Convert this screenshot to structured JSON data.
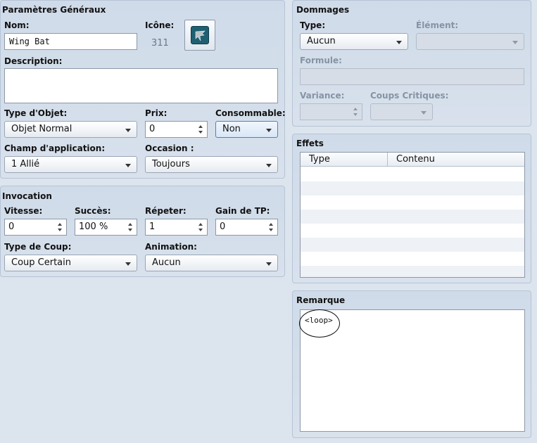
{
  "general": {
    "title": "Paramètres Généraux",
    "name_label": "Nom:",
    "name_value": "Wing Bat",
    "icon_label": "Icône:",
    "icon_index": "311",
    "icon_name": "bat-wing-icon",
    "description_label": "Description:",
    "description_value": "",
    "item_type_label": "Type d'Objet:",
    "item_type_value": "Objet Normal",
    "price_label": "Prix:",
    "price_value": "0",
    "consumable_label": "Consommable:",
    "consumable_value": "Non",
    "scope_label": "Champ d'application:",
    "scope_value": "1 Allié",
    "occasion_label": "Occasion :",
    "occasion_value": "Toujours"
  },
  "invocation": {
    "title": "Invocation",
    "speed_label": "Vitesse:",
    "speed_value": "0",
    "success_label": "Succès:",
    "success_value": "100 %",
    "repeat_label": "Répeter:",
    "repeat_value": "1",
    "tp_gain_label": "Gain de TP:",
    "tp_gain_value": "0",
    "hit_type_label": "Type de Coup:",
    "hit_type_value": "Coup Certain",
    "animation_label": "Animation:",
    "animation_value": "Aucun"
  },
  "damage": {
    "title": "Dommages",
    "type_label": "Type:",
    "type_value": "Aucun",
    "element_label": "Élément:",
    "element_value": "",
    "formula_label": "Formule:",
    "formula_value": "",
    "variance_label": "Variance:",
    "variance_value": "",
    "critical_label": "Coups Critiques:",
    "critical_value": ""
  },
  "effects": {
    "title": "Effets",
    "columns": [
      "Type",
      "Contenu"
    ],
    "rows": []
  },
  "note": {
    "title": "Remarque",
    "value": "<loop>"
  },
  "colors": {
    "panel": "#cfdbe9",
    "background": "#dce4ee",
    "accent": "#4d7fc0",
    "disabled_text": "#8593a4"
  }
}
